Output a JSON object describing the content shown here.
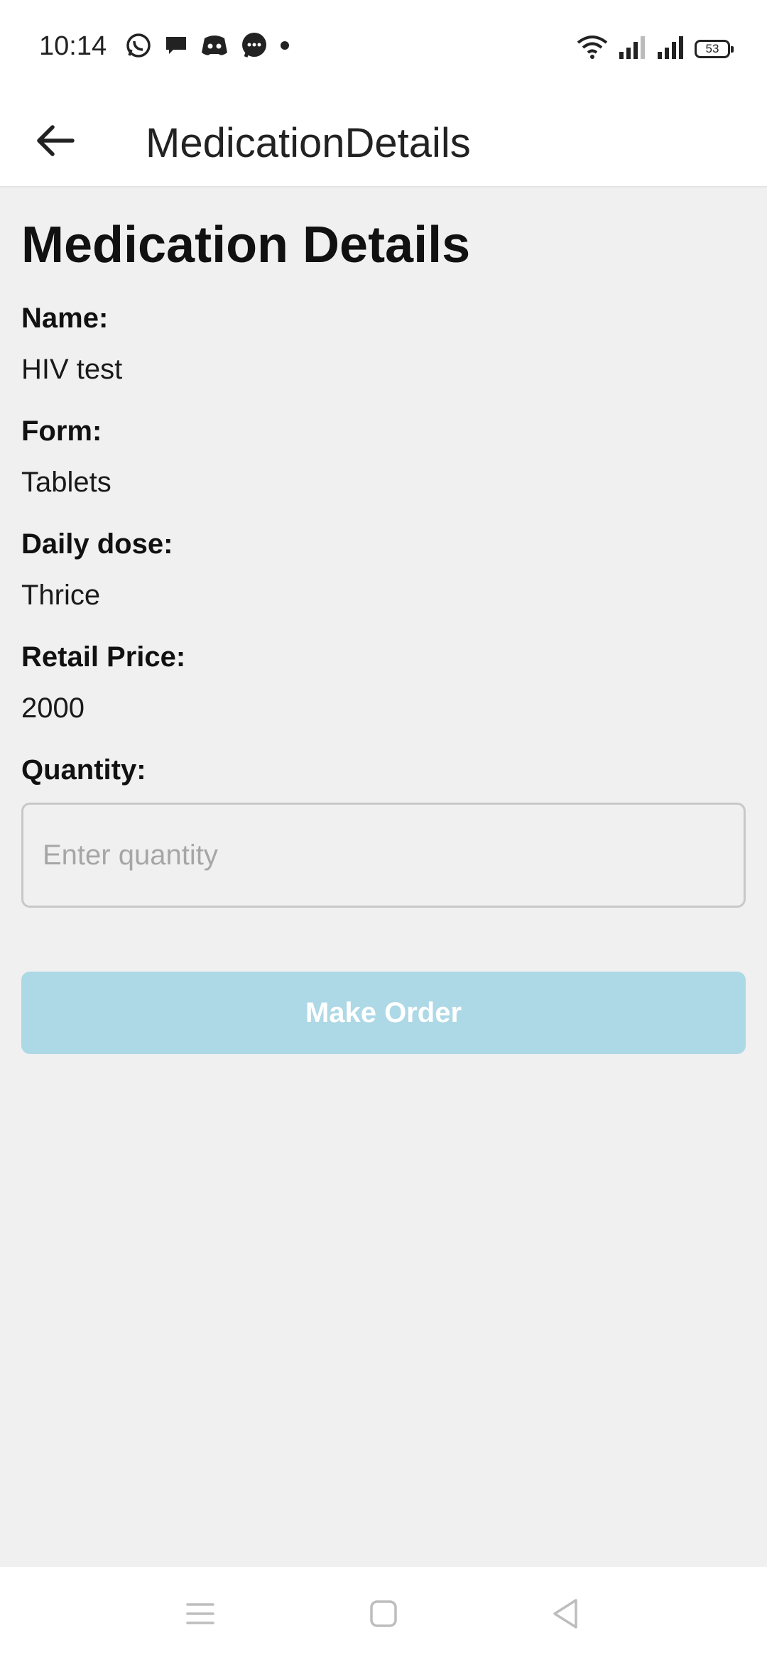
{
  "status_bar": {
    "time": "10:14",
    "notification_icons": [
      "whatsapp-icon",
      "chat-bubble-icon",
      "discord-icon",
      "messenger-icon",
      "dot-icon"
    ],
    "system_icons": [
      "wifi-icon",
      "signal-icon",
      "signal-icon"
    ],
    "battery_level": "53"
  },
  "app_bar": {
    "title": "MedicationDetails",
    "back_icon": "arrow-left-icon"
  },
  "page": {
    "heading": "Medication Details",
    "fields": [
      {
        "label": "Name:",
        "value": "HIV test"
      },
      {
        "label": "Form:",
        "value": "Tablets"
      },
      {
        "label": "Daily dose:",
        "value": "Thrice"
      },
      {
        "label": "Retail Price:",
        "value": "2000"
      }
    ],
    "quantity": {
      "label": "Quantity:",
      "value": "",
      "placeholder": "Enter quantity"
    },
    "order_button_label": "Make Order"
  },
  "colors": {
    "background": "#f0f0f0",
    "bar_background": "#ffffff",
    "button_accent": "#add8e6",
    "button_text": "#ffffff",
    "placeholder_text": "#a6a6a6"
  },
  "nav_bar": {
    "buttons": [
      "menu-icon",
      "home-square-icon",
      "back-triangle-icon"
    ]
  }
}
